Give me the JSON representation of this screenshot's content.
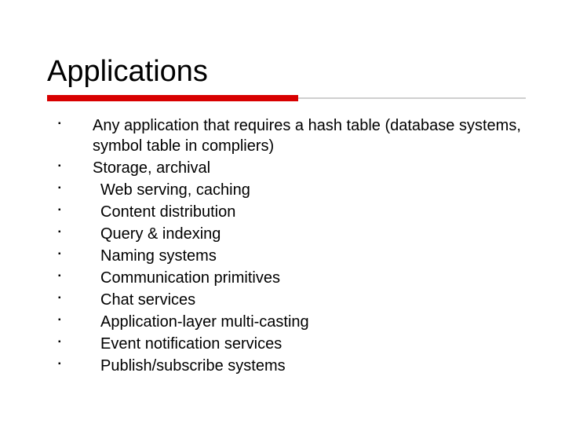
{
  "title": "Applications",
  "bullets": [
    {
      "text": "Any application that requires a hash table (database systems, symbol table in compliers)",
      "indent": false
    },
    {
      "text": "Storage, archival",
      "indent": false
    },
    {
      "text": "Web serving, caching",
      "indent": true
    },
    {
      "text": "Content distribution",
      "indent": true
    },
    {
      "text": "Query & indexing",
      "indent": true
    },
    {
      "text": "Naming systems",
      "indent": true
    },
    {
      "text": "Communication primitives",
      "indent": true
    },
    {
      "text": "Chat services",
      "indent": true
    },
    {
      "text": "Application-layer multi-casting",
      "indent": true
    },
    {
      "text": "Event notification services",
      "indent": true
    },
    {
      "text": "Publish/subscribe systems",
      "indent": true
    }
  ],
  "colors": {
    "accent": "#d80000",
    "rule": "#cfcfcf"
  }
}
